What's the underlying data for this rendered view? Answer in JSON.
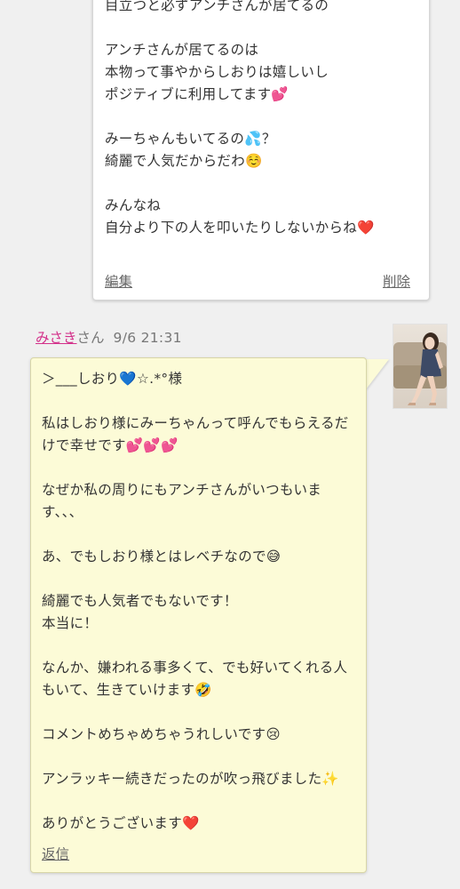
{
  "own_comment": {
    "text": "目立つと必ずアンチさんが居てるの\n\nアンチさんが居てるのは\n本物って事やからしおりは嬉しいし\nポジティブに利用してます💕\n\nみーちゃんもいてるの💦？\n綺麗で人気だからだわ☺️\n\nみんなね\n自分より下の人を叩いたりしないからね❤️",
    "edit_label": "編集",
    "delete_label": "削除"
  },
  "reply": {
    "author": "みさき",
    "author_suffix": "さん",
    "time": "9/6 21:31",
    "avatar_icon": "woman-portrait-photo",
    "text": "＞___しおり💙☆.*°様\n\n私はしおり様にみーちゃんって呼んでもらえるだけで幸せです💕💕💕\n\nなぜか私の周りにもアンチさんがいつもいます、、、\n\nあ、でもしおり様とはレベチなので😅\n\n綺麗でも人気者でもないです！\n本当に！\n\nなんか、嫌われる事多くて、でも好いてくれる人もいて、生きていけます🤣\n\nコメントめちゃめちゃうれしいです😢\n\nアンラッキー続きだったのが吹っ飛びました✨\n\nありがとうございます❤️",
    "reply_label": "返信"
  },
  "colors": {
    "page_bg": "#f0f0f0",
    "own_card_bg": "#ffffff",
    "reply_bubble_bg": "#fcfbd7",
    "author_link": "#d3308a"
  }
}
